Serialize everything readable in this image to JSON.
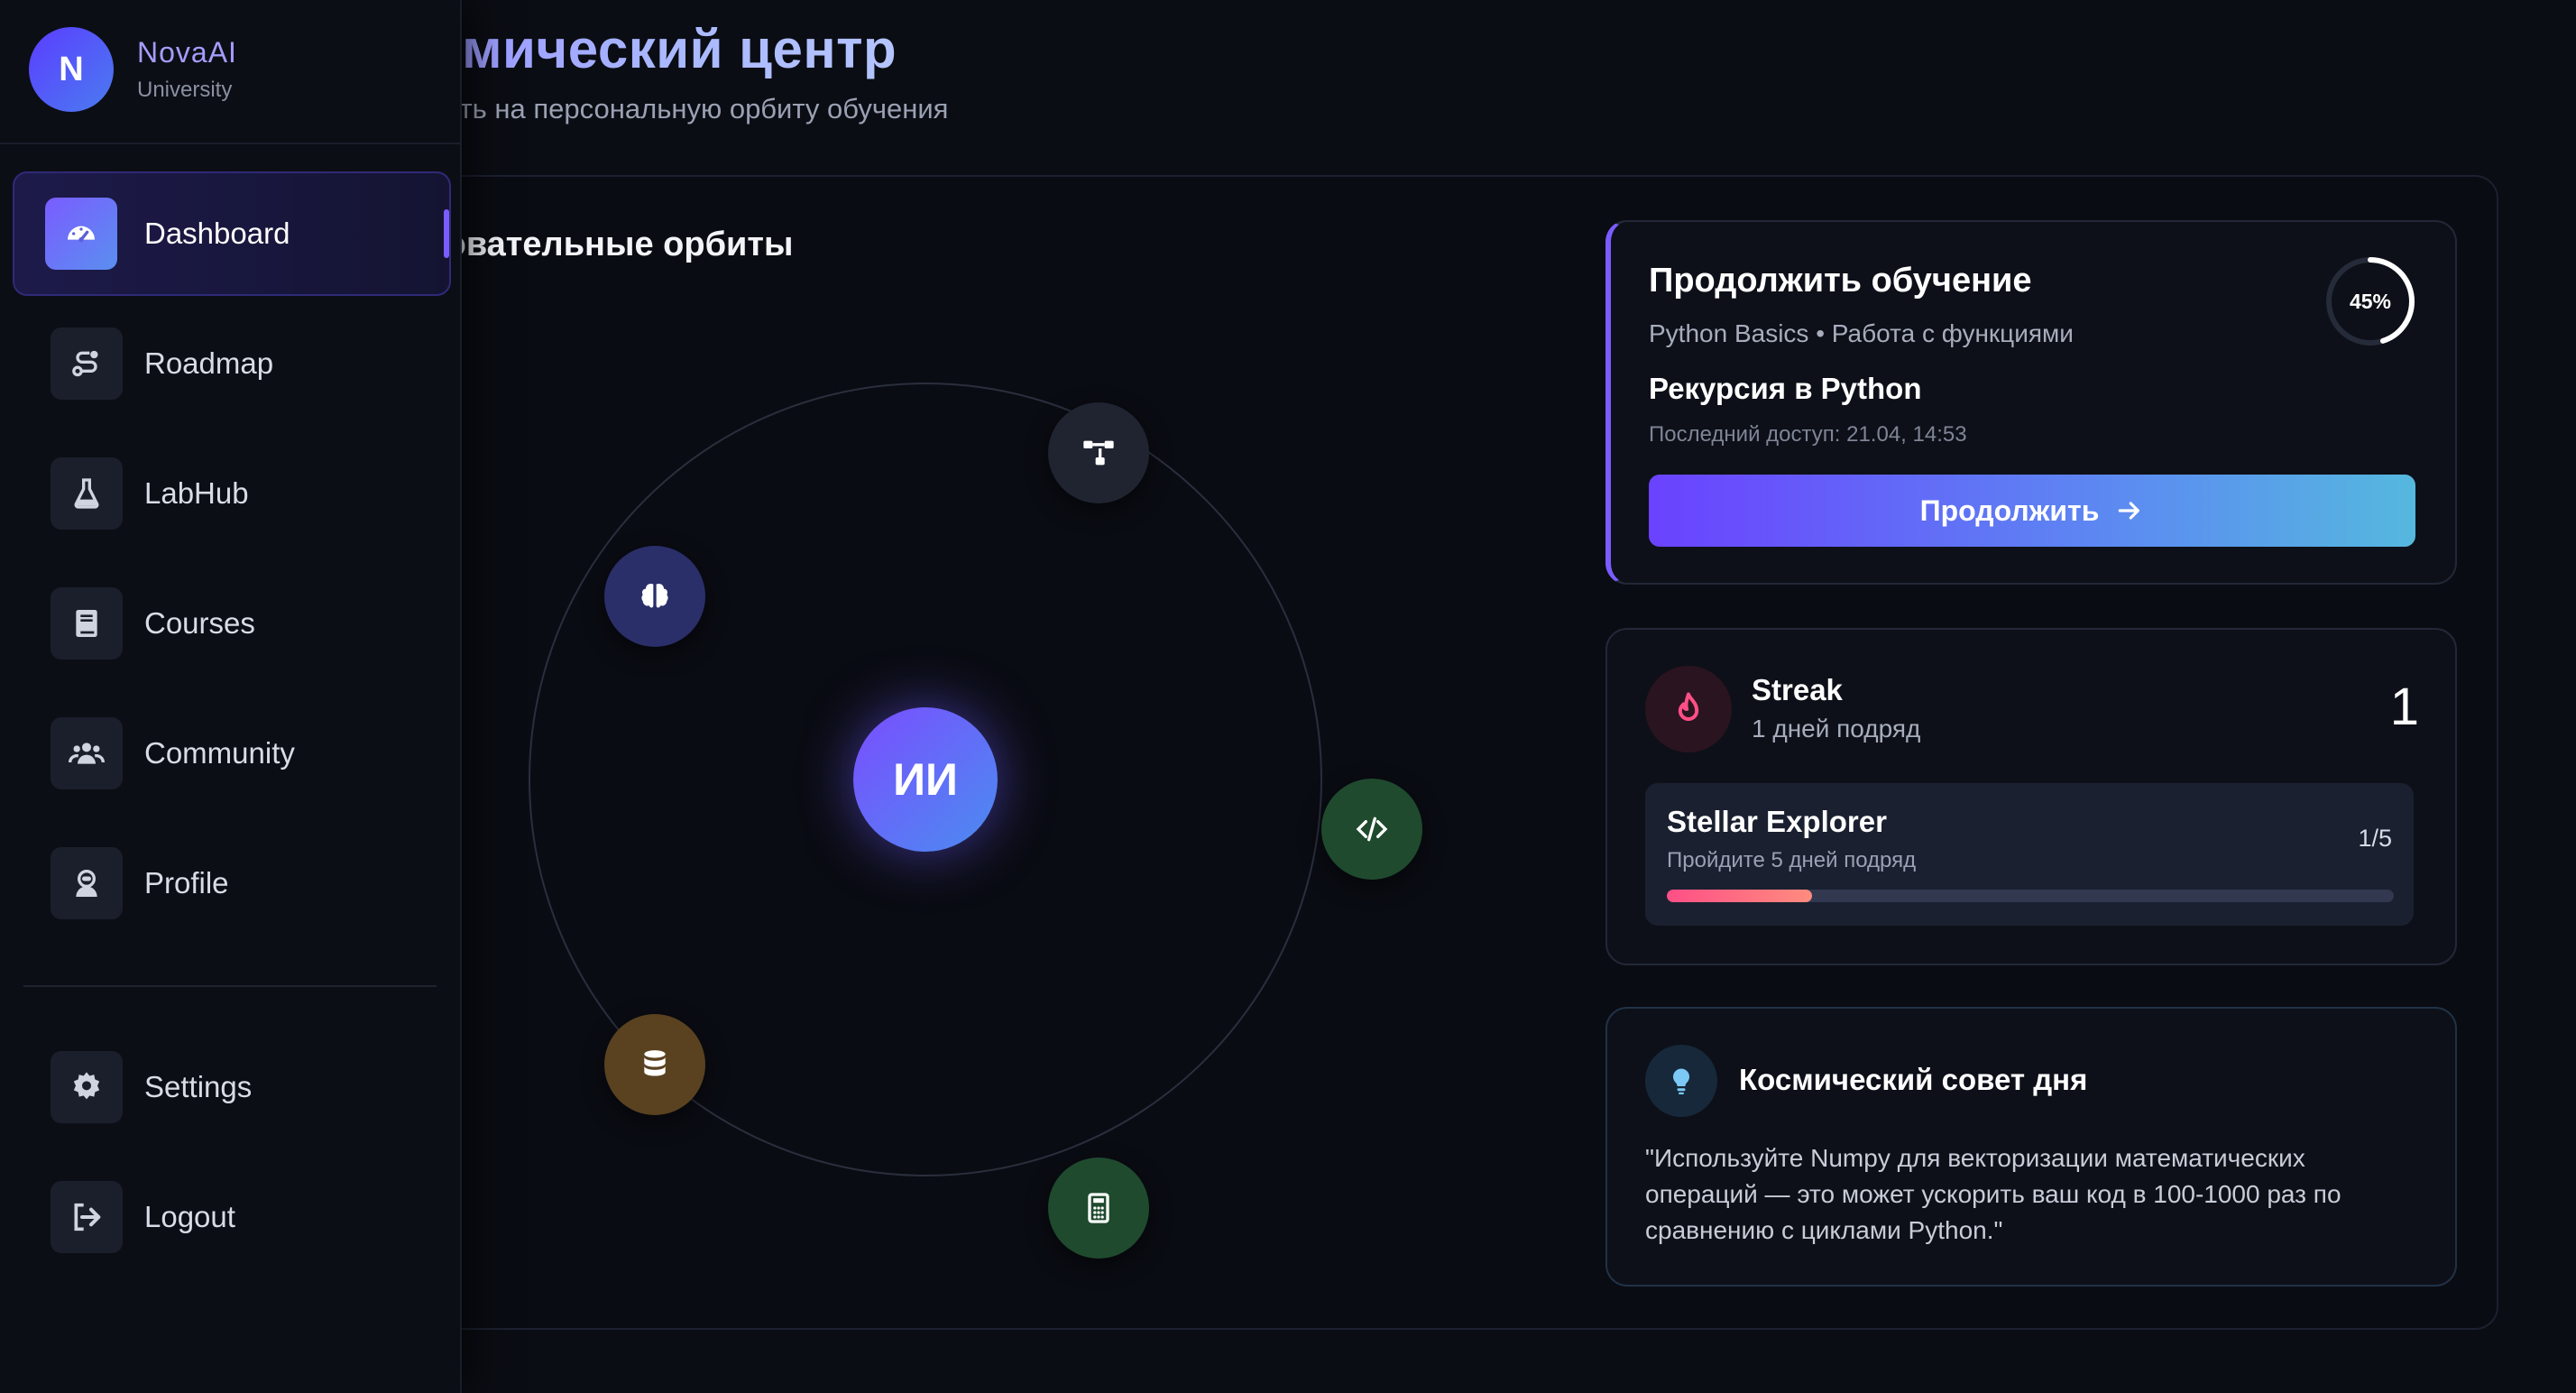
{
  "brand": {
    "initial": "N",
    "name": "NovaAI",
    "subtitle": "University"
  },
  "sidebar": {
    "items": [
      {
        "label": "Dashboard",
        "icon": "gauge-icon",
        "active": true
      },
      {
        "label": "Roadmap",
        "icon": "route-icon"
      },
      {
        "label": "LabHub",
        "icon": "flask-icon"
      },
      {
        "label": "Courses",
        "icon": "book-icon"
      },
      {
        "label": "Community",
        "icon": "users-icon"
      },
      {
        "label": "Profile",
        "icon": "astronaut-icon"
      }
    ],
    "bottom_items": [
      {
        "label": "Settings",
        "icon": "gear-icon"
      },
      {
        "label": "Logout",
        "icon": "logout-icon"
      }
    ]
  },
  "header": {
    "title": "Мой космический центр",
    "subtitle": "Добро пожаловать на персональную орбиту обучения"
  },
  "orbit": {
    "heading": "Ваши образовательные орбиты",
    "core_label": "ИИ",
    "planets": [
      {
        "icon": "network-icon",
        "color": "#202431"
      },
      {
        "icon": "brain-icon",
        "color": "#2a2f6a"
      },
      {
        "icon": "code-icon",
        "color": "#1f4a2e"
      },
      {
        "icon": "database-icon",
        "color": "#5a4220"
      },
      {
        "icon": "calculator-icon",
        "color": "#1f4a2e"
      }
    ]
  },
  "continue": {
    "title": "Продолжить обучение",
    "course": "Python Basics • Работа с функциями",
    "lesson": "Рекурсия в Python",
    "last_access": "Последний доступ: 21.04, 14:53",
    "progress": 45,
    "progress_label": "45%",
    "button": "Продолжить"
  },
  "streak": {
    "title": "Streak",
    "subtitle": "1 дней подряд",
    "count": "1",
    "achievement": {
      "title": "Stellar Explorer",
      "subtitle": "Пройдите 5 дней подряд",
      "count": "1/5",
      "progress": 0.2
    }
  },
  "tip": {
    "title": "Космический совет дня",
    "text": "\"Используйте Numpy для векторизации математических операций — это может ускорить ваш код в 100-1000 раз по сравнению с циклами Python.\""
  },
  "colors": {
    "accent": "#7a5cff",
    "accent2": "#4a8df0",
    "streak": "#ff4f86"
  }
}
